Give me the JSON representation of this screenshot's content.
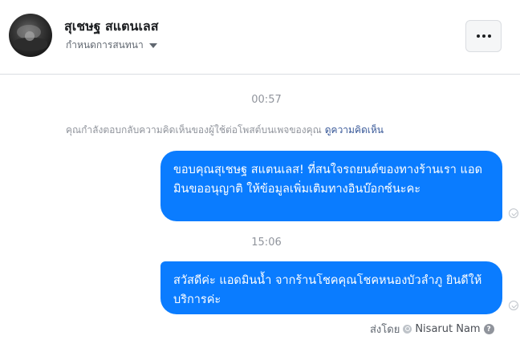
{
  "header": {
    "contact_name": "สุเชษฐ สแตนเลส",
    "settings_label": "กำหนดการสนทนา",
    "more_icon": "more-horizontal-icon"
  },
  "conversation": {
    "timestamps": [
      "00:57",
      "15:06"
    ],
    "context_note": {
      "text": "คุณกำลังตอบกลับความคิดเห็นของผู้ใช้ต่อโพสต์บนเพจของคุณ",
      "link": "ดูความคิดเห็น"
    },
    "messages": [
      {
        "text": "ขอบคุณสุเชษฐ สแตนเลส! ที่สนใจรถยนต์ของทางร้านเรา แอดมินขออนุญาติ ให้ข้อมูลเพิ่มเติมทางอินบ๊อกซ์นะคะ",
        "status_icon": "sent-check-icon"
      },
      {
        "text": "สวัสดีค่ะ แอดมินน้ำ จากร้านโชคคุณโชคหนองบัวลำภู ยินดีให้บริการค่ะ",
        "status_icon": "sent-check-icon"
      }
    ],
    "sent_by": {
      "label": "ส่งโดย",
      "name": "Nisarut Nam",
      "help_glyph": "?"
    }
  },
  "colors": {
    "bubble": "#0a7cff",
    "link": "#385898",
    "muted": "#90949c"
  }
}
